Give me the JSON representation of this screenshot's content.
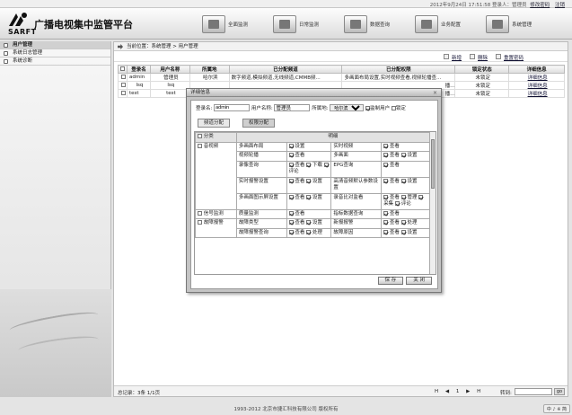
{
  "topbar": {
    "datetime": "2012年9月24日 17:51:58",
    "login_label": "登录人：管理员",
    "change_password": "修改密码",
    "logout": "注销"
  },
  "brand": {
    "logo_text": "SARFT",
    "title": "广播电视集中监管平台"
  },
  "nav": [
    {
      "label": "全面监测",
      "icon": "monitor-icon"
    },
    {
      "label": "日常监测",
      "icon": "daily-icon"
    },
    {
      "label": "数据查询",
      "icon": "query-icon"
    },
    {
      "label": "业务配置",
      "icon": "config-icon"
    },
    {
      "label": "系统管理",
      "icon": "system-icon"
    }
  ],
  "sidebar": {
    "items": [
      {
        "label": "用户管理"
      },
      {
        "label": "系统日志管理"
      },
      {
        "label": "系统诊断"
      }
    ]
  },
  "breadcrumb": "当前位置：系统管理 > 用户管理",
  "toolbar": {
    "add": "新增",
    "delete": "删除",
    "reset_password": "重置密码"
  },
  "table": {
    "headers": [
      "登录名",
      "用户名称",
      "所属地",
      "已分配频道",
      "已分配权限",
      "锁定状态",
      "详细信息"
    ],
    "rows": [
      {
        "login": "admin",
        "name": "管理员",
        "place": "哈尔滨",
        "channels": "数字频道,模拟频道,无线频道,CMMB频...",
        "perms": "多画面布局设置,实时视频查看,视频轮播查...",
        "lock": "未锁定",
        "detail": "详细信息"
      },
      {
        "login": "lsq",
        "name": "lsq",
        "place": "",
        "channels": "",
        "perms": "播...",
        "lock": "未锁定",
        "detail": "详细信息"
      },
      {
        "login": "test",
        "name": "test",
        "place": "",
        "channels": "",
        "perms": "播...",
        "lock": "未锁定",
        "detail": "详细信息"
      }
    ]
  },
  "pager": {
    "summary": "总记录：3条 1/1页",
    "nav": "H ◀ 1 ▶ H",
    "goto_label": "转到:",
    "go": "go"
  },
  "footer": "1993-2012 北京市捷汇科技有限公司 版权所有",
  "corner": "中 ♪ ※ 简",
  "dialog": {
    "title": "详细信息",
    "close": "×",
    "login_label": "登录名:",
    "login_value": "admin",
    "user_label": "用户名称:",
    "user_value": "管理员",
    "place_label": "所属地:",
    "place_value": "哈尔滨",
    "monitor_label": "监制用户",
    "locked_label": "锁定",
    "tabs": [
      "频道分配",
      "权限分配"
    ],
    "col_category": "分类",
    "col_detail": "明细",
    "groups": [
      {
        "name": "音视频",
        "items": [
          {
            "a": "多画面布局",
            "a_opts": [
              "设置"
            ],
            "b": "实时视频",
            "b_opts": [
              "查看"
            ]
          },
          {
            "a": "视频轮播",
            "a_opts": [
              "查看"
            ],
            "b": "多画面",
            "b_opts": [
              "查看",
              "设置"
            ]
          },
          {
            "a": "录像查询",
            "a_opts": [
              "查看",
              "下载",
              "评论"
            ],
            "b": "EPG查询",
            "b_opts": [
              "查看"
            ]
          },
          {
            "a": "实时报警设置",
            "a_opts": [
              "查看",
              "设置"
            ],
            "b": "高清音频默认参数设置",
            "b_opts": [
              "查看",
              "设置"
            ]
          },
          {
            "a": "多画面图示屏设置",
            "a_opts": [
              "查看",
              "设置"
            ],
            "b": "录音比对监看",
            "b_opts": [
              "查看",
              "管理",
              "采集",
              "评论"
            ]
          }
        ]
      },
      {
        "name": "信号监测",
        "items": [
          {
            "a": "质量监测",
            "a_opts": [
              "查看"
            ],
            "b": "指标数据查询",
            "b_opts": [
              "查看"
            ]
          }
        ]
      },
      {
        "name": "故障报警",
        "items": [
          {
            "a": "故障类型",
            "a_opts": [
              "查看",
              "设置"
            ],
            "b": "新报报警",
            "b_opts": [
              "查看",
              "处理"
            ]
          },
          {
            "a": "故障报警查询",
            "a_opts": [
              "查看",
              "处理"
            ],
            "b": "故障原因",
            "b_opts": [
              "查看",
              "设置"
            ]
          }
        ]
      }
    ],
    "save": "保 存",
    "close_btn": "关 闭"
  }
}
